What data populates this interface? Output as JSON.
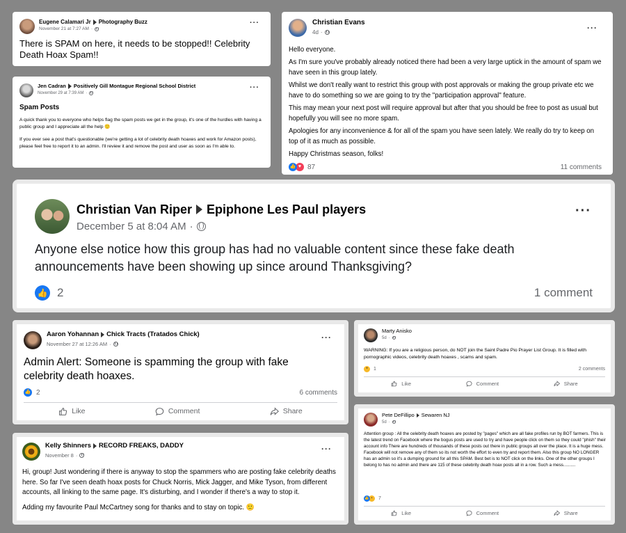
{
  "posts": [
    {
      "author": "Eugene Calamari Jr",
      "group": "Photography Buzz",
      "time": "November 21 at 7:27 AM",
      "body": [
        "There is SPAM on here, it needs to be stopped!! Celebrity Death Hoax Spam!!"
      ]
    },
    {
      "author": "Jen Cadran",
      "group": "Positively Gill Montague Regional School District",
      "time": "November 29 at 7:39 AM",
      "title": "Spam Posts",
      "body": [
        "A quick thank you to everyone who helps flag the spam posts we get in the group, it's one of the hurdles with having a public group and I appreciate all the help 🙂",
        "If you ever see a post that's questionable (we're getting a lot of celebrity death hoaxes and work for Amazon posts), please feel free to report it to an admin. I'll review it and remove the post and user as soon as I'm able to."
      ]
    },
    {
      "author": "Christian Evans",
      "time": "4d",
      "body": [
        "Hello everyone.",
        "As I'm sure you've probably already noticed there had been a very large uptick in the amount of spam we have seen in this group lately.",
        "Whilst we don't really want to restrict this group with post approvals or making the group private etc we have to do something so we are going to try the \"participation approval\" feature.",
        "This may mean your next post will require approval but after that you should be free to post as usual but hopefully you will see no more spam.",
        "Apologies for any inconvenience & for all of the spam you have seen lately. We really do try to keep on top of it as much as possible.",
        "Happy Christmas season, folks!"
      ],
      "reactions": "87",
      "comments": "11 comments"
    },
    {
      "author": "Christian Van Riper",
      "group": "Epiphone Les Paul players",
      "time": "December 5 at 8:04 AM",
      "body": [
        "Anyone else notice how this group has had no valuable content since these fake death announcements have been showing up since around Thanksgiving?"
      ],
      "reactions": "2",
      "comments": "1 comment"
    },
    {
      "author": "Aaron Yohannan",
      "group": "Chick Tracts (Tratados Chick)",
      "time": "November 27 at 12:26 AM",
      "body": [
        "Admin Alert: Someone is spamming the group with fake celebrity death hoaxes."
      ],
      "reactions": "2",
      "comments": "6 comments",
      "actions": [
        "Like",
        "Comment",
        "Share"
      ]
    },
    {
      "author": "Kelly Shinners",
      "group": "RECORD FREAKS, DADDY",
      "time": "November 8",
      "body": [
        "Hi, group!  Just wondering if there is anyway to stop the spammers who are posting fake celebrity deaths here. So far I've seen death hoax posts for Chuck Norris, Mick Jagger, and Mike Tyson, from different accounts, all linking to the same page. It's disturbing, and I wonder if there's a way to stop it.",
        "Adding my favourite Paul McCartney song for thanks and to stay on topic. 🙂"
      ]
    },
    {
      "author": "Marty Anisko",
      "time": "5d",
      "body": [
        "WARNING: If you are a religious person, do NOT join the Saint Padre Pio Prayer List Group. It is filled with pornographic videos,  celebrity death hoaxes , scams and spam."
      ],
      "reactions": "1",
      "comments": "2 comments",
      "actions": [
        "Like",
        "Comment",
        "Share"
      ]
    },
    {
      "author": "Pete DeFillipo",
      "group": "Sewaren NJ",
      "time": "5d",
      "body": [
        "Attention group : All the celebrity death hoaxes are posted by \"pages\" which are all fake profiles run by BOT farmers.  This is the latest trend on Facebook where the bogus posts are used to try and have people click on them so they could \"phish\" their account info   There are hundreds of thousands of these posts out there in public groups all over the place.  It is a huge mess. Facebook will not remove any of them so its not worth the effort to even try and report them. Also this group NO LONGER has an admin so it's a dumping ground for all  this SPAM.  Best bet is to NOT click on the links.  One of the other groups I belong to has no admin and there are 115 of these celebrity death hoax posts all in a row.    Such a mess.........."
      ],
      "reactions": "7",
      "actions": [
        "Like",
        "Comment",
        "Share"
      ]
    }
  ],
  "icons": [
    "profile-avatar",
    "globe-icon",
    "more-icon",
    "like-reaction-icon",
    "love-reaction-icon",
    "wow-reaction-icon",
    "haha-reaction-icon",
    "like-icon",
    "comment-icon",
    "share-icon"
  ],
  "colors": {
    "background": "#868686",
    "accent": "#1877f2",
    "love": "#f33e58",
    "secondary_text": "#65676b"
  }
}
